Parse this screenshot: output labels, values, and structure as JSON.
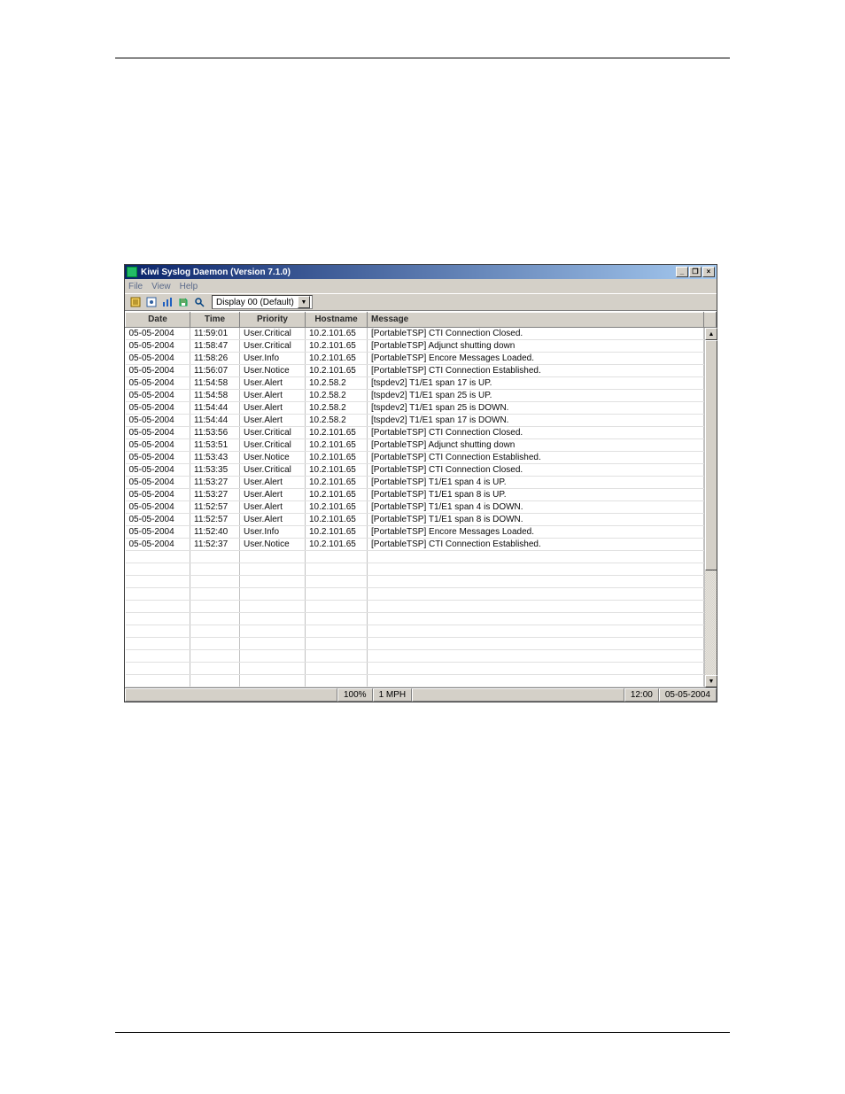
{
  "window": {
    "title": "Kiwi Syslog Daemon (Version 7.1.0)",
    "min_label": "_",
    "max_label": "❐",
    "close_label": "×"
  },
  "menu": {
    "file": "File",
    "view": "View",
    "help": "Help"
  },
  "toolbar": {
    "display_selected": "Display 00 (Default)",
    "icon_log": "log-icon",
    "icon_props": "properties-icon",
    "icon_chart": "chart-icon",
    "icon_save": "save-icon",
    "icon_find": "find-icon"
  },
  "columns": {
    "date": "Date",
    "time": "Time",
    "priority": "Priority",
    "hostname": "Hostname",
    "message": "Message"
  },
  "rows": [
    {
      "date": "05-05-2004",
      "time": "11:59:01",
      "priority": "User.Critical",
      "host": "10.2.101.65",
      "msg": "[PortableTSP] CTI Connection Closed."
    },
    {
      "date": "05-05-2004",
      "time": "11:58:47",
      "priority": "User.Critical",
      "host": "10.2.101.65",
      "msg": "[PortableTSP] Adjunct shutting down"
    },
    {
      "date": "05-05-2004",
      "time": "11:58:26",
      "priority": "User.Info",
      "host": "10.2.101.65",
      "msg": "[PortableTSP] Encore Messages Loaded."
    },
    {
      "date": "05-05-2004",
      "time": "11:56:07",
      "priority": "User.Notice",
      "host": "10.2.101.65",
      "msg": "[PortableTSP] CTI Connection Established."
    },
    {
      "date": "05-05-2004",
      "time": "11:54:58",
      "priority": "User.Alert",
      "host": "10.2.58.2",
      "msg": "[tspdev2] T1/E1 span 17 is UP."
    },
    {
      "date": "05-05-2004",
      "time": "11:54:58",
      "priority": "User.Alert",
      "host": "10.2.58.2",
      "msg": "[tspdev2] T1/E1 span 25 is UP."
    },
    {
      "date": "05-05-2004",
      "time": "11:54:44",
      "priority": "User.Alert",
      "host": "10.2.58.2",
      "msg": "[tspdev2] T1/E1 span 25 is DOWN."
    },
    {
      "date": "05-05-2004",
      "time": "11:54:44",
      "priority": "User.Alert",
      "host": "10.2.58.2",
      "msg": "[tspdev2] T1/E1 span 17 is DOWN."
    },
    {
      "date": "05-05-2004",
      "time": "11:53:56",
      "priority": "User.Critical",
      "host": "10.2.101.65",
      "msg": "[PortableTSP] CTI Connection Closed."
    },
    {
      "date": "05-05-2004",
      "time": "11:53:51",
      "priority": "User.Critical",
      "host": "10.2.101.65",
      "msg": "[PortableTSP] Adjunct shutting down"
    },
    {
      "date": "05-05-2004",
      "time": "11:53:43",
      "priority": "User.Notice",
      "host": "10.2.101.65",
      "msg": "[PortableTSP] CTI Connection Established."
    },
    {
      "date": "05-05-2004",
      "time": "11:53:35",
      "priority": "User.Critical",
      "host": "10.2.101.65",
      "msg": "[PortableTSP] CTI Connection Closed."
    },
    {
      "date": "05-05-2004",
      "time": "11:53:27",
      "priority": "User.Alert",
      "host": "10.2.101.65",
      "msg": "[PortableTSP] T1/E1 span  4 is UP."
    },
    {
      "date": "05-05-2004",
      "time": "11:53:27",
      "priority": "User.Alert",
      "host": "10.2.101.65",
      "msg": "[PortableTSP] T1/E1 span  8 is UP."
    },
    {
      "date": "05-05-2004",
      "time": "11:52:57",
      "priority": "User.Alert",
      "host": "10.2.101.65",
      "msg": "[PortableTSP] T1/E1 span  4 is DOWN."
    },
    {
      "date": "05-05-2004",
      "time": "11:52:57",
      "priority": "User.Alert",
      "host": "10.2.101.65",
      "msg": "[PortableTSP] T1/E1 span  8 is DOWN."
    },
    {
      "date": "05-05-2004",
      "time": "11:52:40",
      "priority": "User.Info",
      "host": "10.2.101.65",
      "msg": "[PortableTSP] Encore Messages Loaded."
    },
    {
      "date": "05-05-2004",
      "time": "11:52:37",
      "priority": "User.Notice",
      "host": "10.2.101.65",
      "msg": "[PortableTSP] CTI Connection Established."
    }
  ],
  "empty_rows": 11,
  "status": {
    "percent": "100%",
    "mph": "1 MPH",
    "time": "12:00",
    "date": "05-05-2004"
  }
}
